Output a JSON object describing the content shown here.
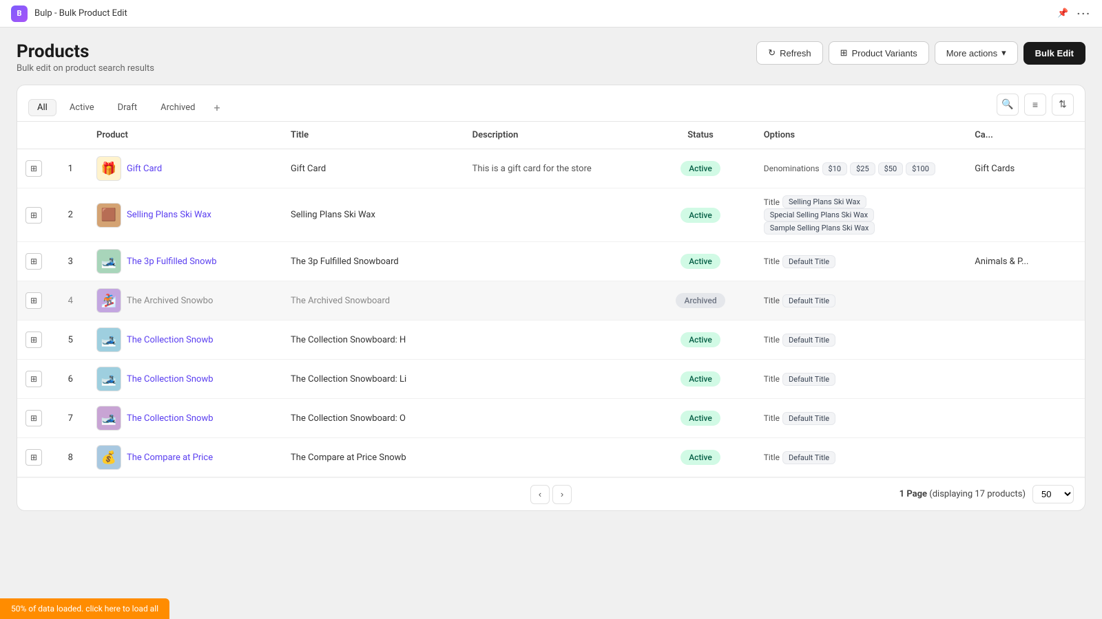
{
  "topbar": {
    "app_name": "Bulp - Bulk Product Edit",
    "logo_text": "B",
    "pin_icon": "📌",
    "more_icon": "···"
  },
  "header": {
    "title": "Products",
    "subtitle": "Bulk edit on product search results",
    "actions": {
      "refresh": "Refresh",
      "product_variants": "Product Variants",
      "more_actions": "More actions",
      "bulk_edit": "Bulk Edit"
    }
  },
  "tabs": {
    "items": [
      "All",
      "Active",
      "Draft",
      "Archived"
    ],
    "active": "All",
    "plus": "+"
  },
  "table": {
    "columns": [
      "",
      "",
      "Product",
      "Title",
      "Description",
      "Status",
      "Options",
      "Ca..."
    ],
    "rows": [
      {
        "num": 1,
        "product_emoji": "🎁",
        "product_name": "Gift Card",
        "title": "Gift Card",
        "description": "This is a gift card for the store",
        "status": "Active",
        "options": [
          {
            "label": "Denominations",
            "tags": [
              "$10",
              "$25",
              "$50",
              "$100"
            ]
          }
        ],
        "category": "Gift Cards",
        "archived": false
      },
      {
        "num": 2,
        "product_emoji": "🟫",
        "product_name": "Selling Plans Ski Wax",
        "title": "Selling Plans Ski Wax",
        "description": "",
        "status": "Active",
        "options": [
          {
            "label": "Title",
            "tags": [
              "Selling Plans Ski Wax"
            ]
          },
          {
            "label": "",
            "tags": [
              "Special Selling Plans Ski Wax"
            ]
          },
          {
            "label": "",
            "tags": [
              "Sample Selling Plans Ski Wax"
            ]
          }
        ],
        "category": "",
        "archived": false
      },
      {
        "num": 3,
        "product_emoji": "🎿",
        "product_name": "The 3p Fulfilled Snowb",
        "title": "The 3p Fulfilled Snowboard",
        "description": "",
        "status": "Active",
        "options": [
          {
            "label": "Title",
            "tags": [
              "Default Title"
            ]
          }
        ],
        "category": "Animals & P...",
        "archived": false
      },
      {
        "num": 4,
        "product_emoji": "🏂",
        "product_name": "The Archived Snowbo",
        "title": "The Archived Snowboard",
        "description": "",
        "status": "Archived",
        "options": [
          {
            "label": "Title",
            "tags": [
              "Default Title"
            ]
          }
        ],
        "category": "",
        "archived": true
      },
      {
        "num": 5,
        "product_emoji": "🎿",
        "product_name": "The Collection Snowb",
        "title": "The Collection Snowboard: H",
        "description": "",
        "status": "Active",
        "options": [
          {
            "label": "Title",
            "tags": [
              "Default Title"
            ]
          }
        ],
        "category": "",
        "archived": false
      },
      {
        "num": 6,
        "product_emoji": "🎿",
        "product_name": "The Collection Snowb",
        "title": "The Collection Snowboard: Li",
        "description": "",
        "status": "Active",
        "options": [
          {
            "label": "Title",
            "tags": [
              "Default Title"
            ]
          }
        ],
        "category": "",
        "archived": false
      },
      {
        "num": 7,
        "product_emoji": "🎿",
        "product_name": "The Collection Snowb",
        "title": "The Collection Snowboard: O",
        "description": "",
        "status": "Active",
        "options": [
          {
            "label": "Title",
            "tags": [
              "Default Title"
            ]
          }
        ],
        "category": "",
        "archived": false
      },
      {
        "num": 8,
        "product_emoji": "💲",
        "product_name": "The Compare at Price",
        "title": "The Compare at Price Snowb",
        "description": "",
        "status": "Active",
        "options": [
          {
            "label": "Title",
            "tags": [
              "Default Title"
            ]
          }
        ],
        "category": "",
        "archived": false
      }
    ]
  },
  "pagination": {
    "page_label": "1 Page",
    "showing": "(displaying 17 products)",
    "per_page": "50",
    "prev_icon": "‹",
    "next_icon": "›"
  },
  "toast": {
    "text": "50% of data loaded. click here to load all"
  }
}
